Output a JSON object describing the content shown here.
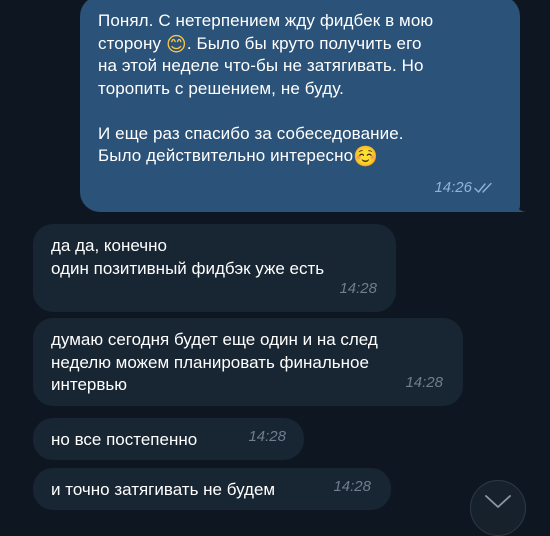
{
  "messages": [
    {
      "direction": "outgoing",
      "text_before_emoji": "Понял. С нетерпением жду фидбек в мою\nсторону ",
      "emoji_1": "😊",
      "text_after_emoji": ". Было бы круто получить его\nна этой неделе что-бы не затягивать. Но\nторопить с решением, не буду.\n\nИ еще раз спасибо за собеседование.\nБыло действительно интересно",
      "emoji_2": "☺️",
      "time": "14:26",
      "status": "read"
    },
    {
      "direction": "incoming",
      "text": "да да, конечно\nодин позитивный фидбэк уже есть",
      "time": "14:28"
    },
    {
      "direction": "incoming",
      "text": "думаю сегодня будет еще один и на след\nнеделю можем планировать финальное\nинтервью",
      "time": "14:28"
    },
    {
      "direction": "incoming",
      "text": "но все постепенно",
      "time": "14:28"
    },
    {
      "direction": "incoming",
      "text": "и точно затягивать не будем",
      "time": "14:28"
    }
  ],
  "icons": {
    "read_status": "double-check-icon",
    "scroll_down": "chevron-down-icon"
  },
  "colors": {
    "background": "#0e1621",
    "outgoing_bubble": "#2b5278",
    "incoming_bubble": "#182533",
    "outgoing_time": "#8fb3d6",
    "incoming_time": "#6d7f8f"
  }
}
